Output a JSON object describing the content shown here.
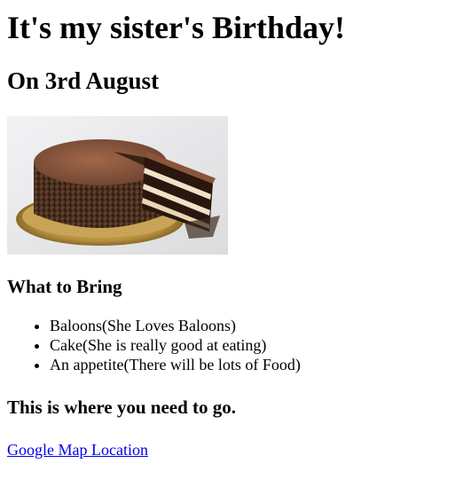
{
  "heading": "It's my sister's Birthday!",
  "subheading": "On 3rd August",
  "image": {
    "name": "chocolate-cake-image"
  },
  "bring_section": {
    "title": "What to Bring",
    "items": [
      "Baloons(She Loves Baloons)",
      "Cake(She is really good at eating)",
      "An appetite(There will be lots of Food)"
    ]
  },
  "location_section": {
    "title": "This is where you need to go.",
    "link_label": "Google Map Location"
  },
  "colors": {
    "link": "#0000ee",
    "text": "#000000",
    "background": "#ffffff"
  }
}
